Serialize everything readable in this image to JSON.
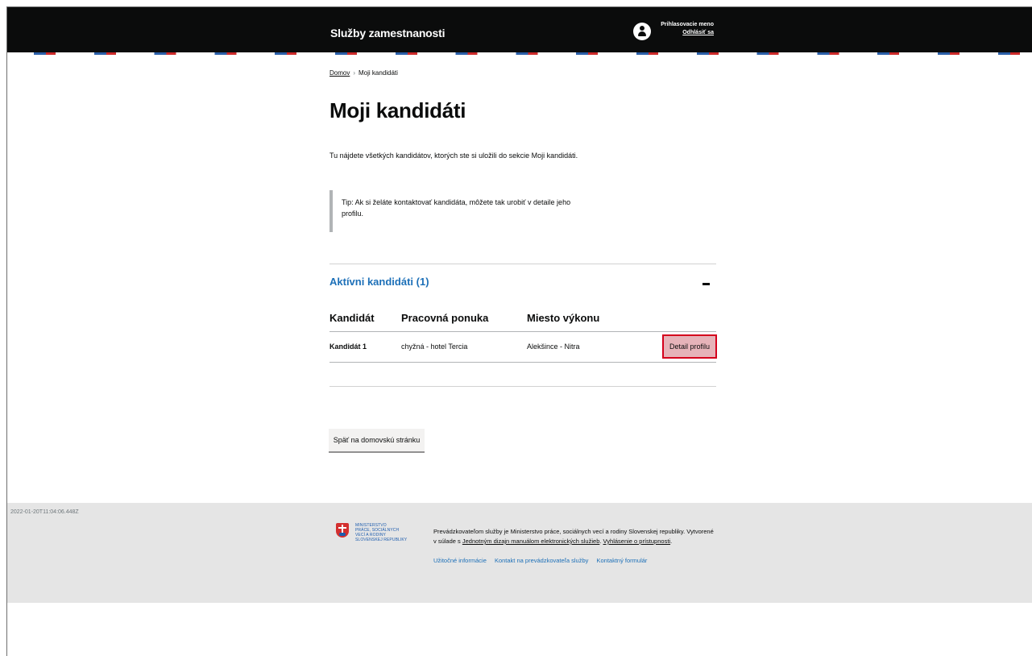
{
  "header": {
    "title": "Služby zamestnanosti",
    "user_name": "Prihlasovacie meno",
    "logout": "Odhlásiť sa"
  },
  "breadcrumb": {
    "home": "Domov",
    "current": "Moji kandidáti"
  },
  "page": {
    "title": "Moji kandidáti",
    "intro": "Tu nájdete všetkých kandidátov, ktorých ste si uložili do sekcie Moji kandidáti.",
    "tip_line1": "Tip: Ak si želáte kontaktovať kandidáta, môžete tak urobiť v detaile jeho",
    "tip_line2": "profilu."
  },
  "accordion": {
    "title": "Aktívni kandidáti (1)",
    "expanded": true
  },
  "table": {
    "headers": [
      "Kandidát",
      "Pracovná ponuka",
      "Miesto výkonu"
    ],
    "rows": [
      {
        "candidate": "Kandidát 1",
        "job": "chyžná - hotel Tercia",
        "location": "Alekšince - Nitra",
        "action": "Detail profilu"
      }
    ]
  },
  "back_button": "Späť na domovskú stránku",
  "footer": {
    "timestamp": "2022-01-20T11:04:06.448Z",
    "logo_lines": [
      "MINISTERSTVO",
      "PRÁCE, SOCIÁLNYCH",
      "VECÍ A RODINY",
      "SLOVENSKEJ REPUBLIKY"
    ],
    "text_1": "Prevádzkovateľom služby je Ministerstvo práce, sociálnych vecí a rodiny Slovenskej republiky. Vytvorené",
    "text_2_prefix": "v súlade s ",
    "text_2_link": "Jednotným dizajn manuálom elektronických služieb",
    "text_2_mid": ". ",
    "text_2_link2": "Vyhlásenie o prístupnosti",
    "text_2_suffix": ".",
    "links": [
      "Užitočné informácie",
      "Kontakt na prevádzkovateľa služby",
      "Kontaktný formulár"
    ]
  },
  "colors": {
    "header_bg": "#0b0c0c",
    "link_blue": "#1d70b8",
    "detail_button_bg": "#e6b3b9",
    "detail_button_border": "#d4001c",
    "footer_bg": "#e5e5e5"
  }
}
